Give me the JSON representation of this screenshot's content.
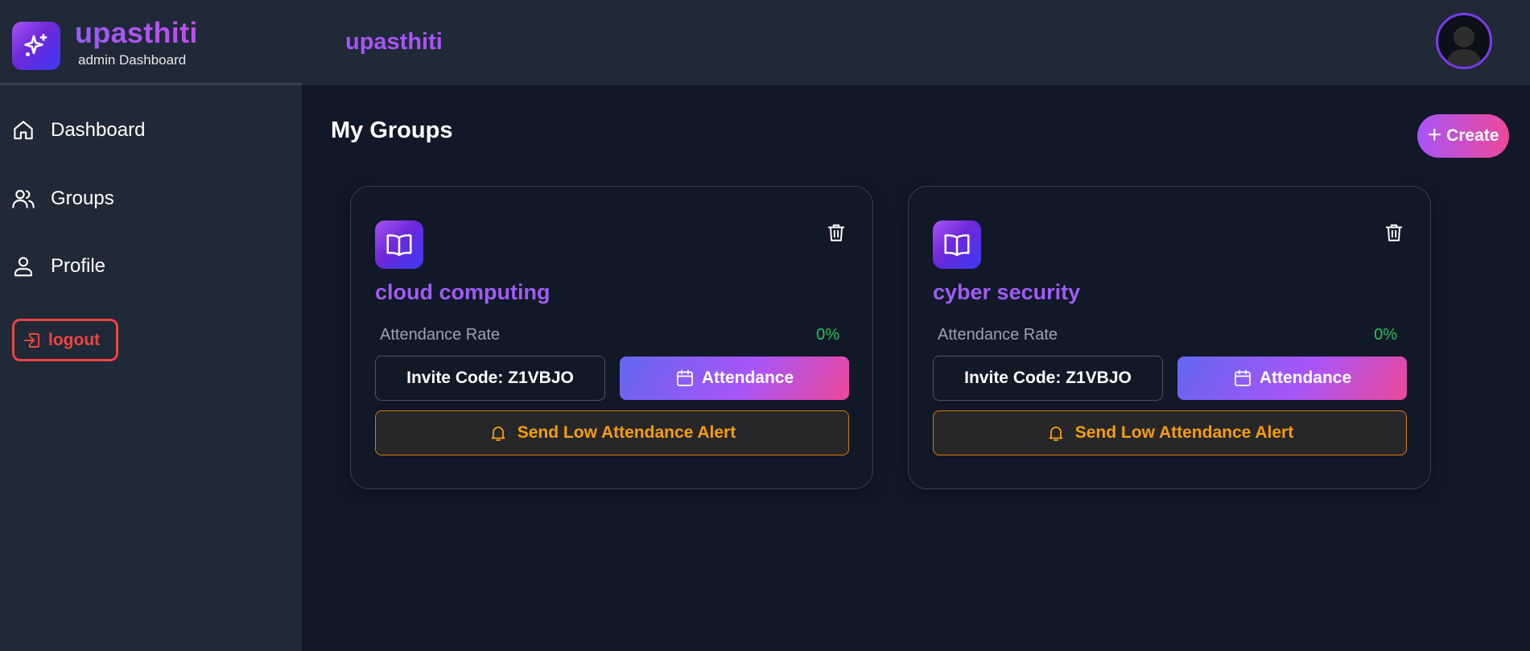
{
  "brand": {
    "title": "upasthiti",
    "subtitle": "admin Dashboard",
    "logo_icon": "sparkles-icon"
  },
  "header": {
    "title": "upasthiti",
    "avatar_icon": "user-avatar-icon"
  },
  "sidebar": {
    "items": [
      {
        "label": "Dashboard",
        "icon": "home-icon"
      },
      {
        "label": "Groups",
        "icon": "users-icon"
      },
      {
        "label": "Profile",
        "icon": "user-icon"
      }
    ],
    "logout_label": "logout"
  },
  "main": {
    "title": "My Groups",
    "create_label": "Create"
  },
  "groups": [
    {
      "name": "cloud computing",
      "rate_label": "Attendance Rate",
      "rate_value": "0%",
      "invite_label": "Invite Code: Z1VBJO",
      "attendance_label": "Attendance",
      "alert_label": "Send Low Attendance Alert"
    },
    {
      "name": "cyber security",
      "rate_label": "Attendance Rate",
      "rate_value": "0%",
      "invite_label": "Invite Code: Z1VBJO",
      "attendance_label": "Attendance",
      "alert_label": "Send Low Attendance Alert"
    }
  ],
  "colors": {
    "background": "#111827",
    "panel": "#1f2937",
    "accent_purple": "#a855f7",
    "accent_pink": "#ec4899",
    "danger": "#ef4444",
    "success": "#22c55e",
    "warning": "#f59e0b"
  }
}
